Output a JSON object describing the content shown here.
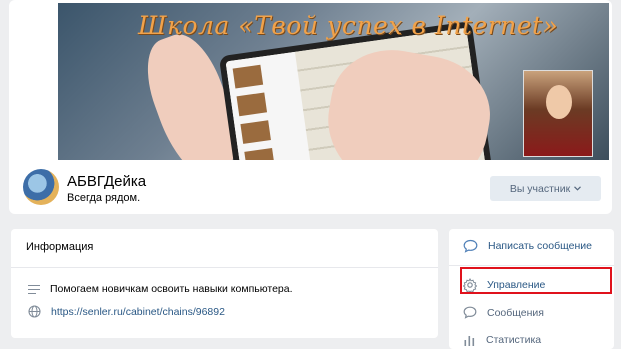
{
  "cover": {
    "title": "Школа «Твой успех в Internet»"
  },
  "group": {
    "name": "АБВГДейка",
    "status": "Всегда рядом.",
    "member_button": "Вы участник"
  },
  "info": {
    "title": "Информация",
    "description": "Помогаем новичкам освоить навыки компьютера.",
    "link": "https://senler.ru/cabinet/chains/96892"
  },
  "menu": {
    "items": [
      {
        "label": "Написать сообщение",
        "icon": "chat-bubble-icon"
      },
      {
        "label": "Управление",
        "icon": "gear-icon"
      },
      {
        "label": "Сообщения",
        "icon": "message-icon"
      },
      {
        "label": "Статистика",
        "icon": "bar-chart-icon"
      }
    ]
  },
  "colors": {
    "link": "#2a5885",
    "highlight": "#e0121c",
    "background": "#edeef0"
  }
}
